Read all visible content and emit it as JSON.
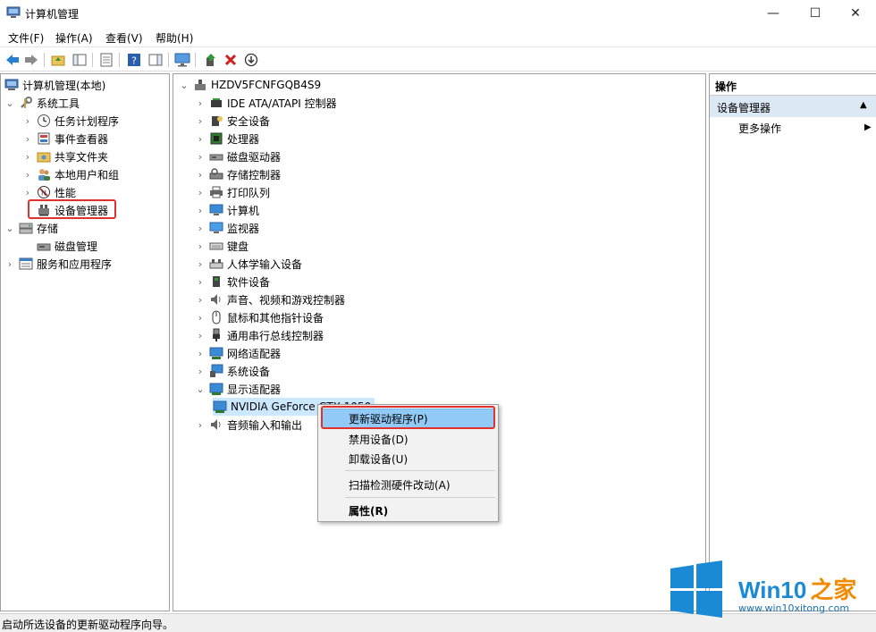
{
  "window": {
    "title": "计算机管理",
    "minimize": "—",
    "maximize": "☐",
    "close": "✕"
  },
  "menu": [
    "文件(F)",
    "操作(A)",
    "查看(V)",
    "帮助(H)"
  ],
  "toolbar_icons": [
    "back-icon",
    "forward-icon",
    "up-folder-icon",
    "show-tree-icon",
    "properties-icon",
    "help-icon",
    "action-pane-icon",
    "monitor-icon",
    "update-driver-icon",
    "uninstall-icon",
    "disable-icon"
  ],
  "left_tree": {
    "root": "计算机管理(本地)",
    "system_tools": "系统工具",
    "task_scheduler": "任务计划程序",
    "event_viewer": "事件查看器",
    "shared_folders": "共享文件夹",
    "local_users": "本地用户和组",
    "performance": "性能",
    "device_manager": "设备管理器",
    "storage": "存储",
    "disk_mgmt": "磁盘管理",
    "services": "服务和应用程序"
  },
  "device_tree": {
    "computer": "HZDV5FCNFGQB4S9",
    "categories": [
      "IDE ATA/ATAPI 控制器",
      "安全设备",
      "处理器",
      "磁盘驱动器",
      "存储控制器",
      "打印队列",
      "计算机",
      "监视器",
      "键盘",
      "人体学输入设备",
      "软件设备",
      "声音、视频和游戏控制器",
      "鼠标和其他指针设备",
      "通用串行总线控制器",
      "网络适配器",
      "系统设备",
      "显示适配器"
    ],
    "gpu": "NVIDIA GeForce GTX 1050",
    "audio_io": "音频输入和输出"
  },
  "context_menu": {
    "update_driver": "更新驱动程序(P)",
    "disable": "禁用设备(D)",
    "uninstall": "卸载设备(U)",
    "scan": "扫描检测硬件改动(A)",
    "properties": "属性(R)"
  },
  "actions": {
    "header": "操作",
    "section": "设备管理器",
    "more": "更多操作"
  },
  "status": "启动所选设备的更新驱动程序向导。",
  "watermark": {
    "brand": "Win10",
    "suffix": "之家",
    "url": "www.win10xitong.com"
  },
  "colors": {
    "highlight_border": "#e0312c",
    "selection": "#cce8ff",
    "menu_hover": "#91c9f7",
    "win_blue": "#1a8ad6"
  }
}
